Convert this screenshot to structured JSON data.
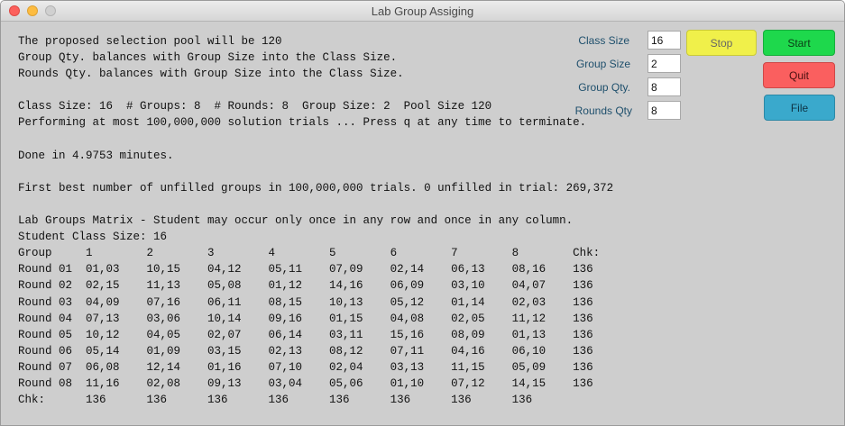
{
  "window": {
    "title": "Lab Group Assiging"
  },
  "output": {
    "lines": [
      "The proposed selection pool will be 120",
      "Group Qty. balances with Group Size into the Class Size.",
      "Rounds Qty. balances with Group Size into the Class Size.",
      "",
      "Class Size: 16  # Groups: 8  # Rounds: 8  Group Size: 2  Pool Size 120",
      "Performing at most 100,000,000 solution trials ... Press q at any time to terminate.",
      "",
      "Done in 4.9753 minutes.",
      "",
      "First best number of unfilled groups in 100,000,000 trials. 0 unfilled in trial: 269,372",
      "",
      "Lab Groups Matrix - Student may occur only once in any row and once in any column.",
      "Student Class Size: 16",
      "Group     1        2        3        4        5        6        7        8        Chk:",
      "Round 01  01,03    10,15    04,12    05,11    07,09    02,14    06,13    08,16    136",
      "Round 02  02,15    11,13    05,08    01,12    14,16    06,09    03,10    04,07    136",
      "Round 03  04,09    07,16    06,11    08,15    10,13    05,12    01,14    02,03    136",
      "Round 04  07,13    03,06    10,14    09,16    01,15    04,08    02,05    11,12    136",
      "Round 05  10,12    04,05    02,07    06,14    03,11    15,16    08,09    01,13    136",
      "Round 06  05,14    01,09    03,15    02,13    08,12    07,11    04,16    06,10    136",
      "Round 07  06,08    12,14    01,16    07,10    02,04    03,13    11,15    05,09    136",
      "Round 08  11,16    02,08    09,13    03,04    05,06    01,10    07,12    14,15    136",
      "Chk:      136      136      136      136      136      136      136      136"
    ]
  },
  "fields": [
    {
      "label": "Class Size",
      "value": "16"
    },
    {
      "label": "Group Size",
      "value": "2"
    },
    {
      "label": "Group Qty.",
      "value": "8"
    },
    {
      "label": "Rounds Qty",
      "value": "8"
    }
  ],
  "buttons": {
    "stop": "Stop",
    "start": "Start",
    "quit": "Quit",
    "file": "File"
  },
  "colors": {
    "stop_bg": "#f0f04a",
    "start_bg": "#1ed84c",
    "quit_bg": "#fa5f5f",
    "file_bg": "#3aa9cc"
  }
}
